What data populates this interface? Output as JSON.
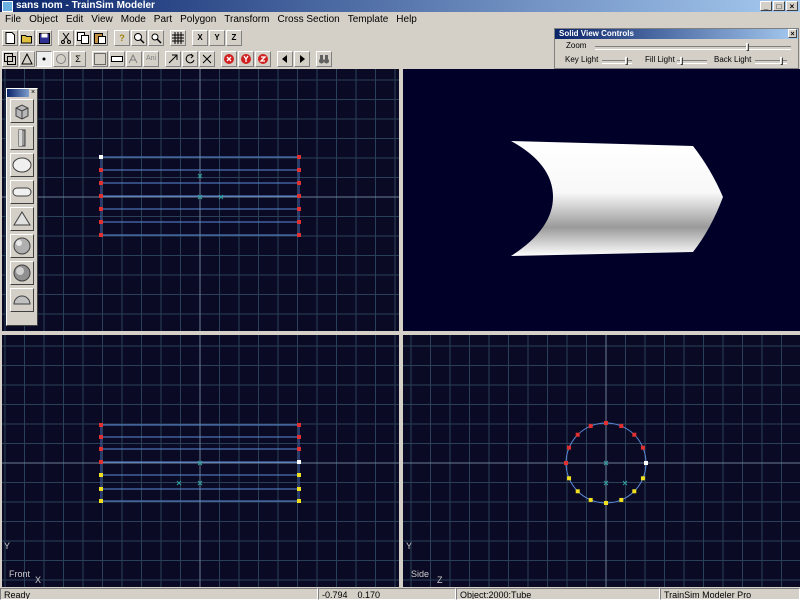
{
  "window": {
    "title": "sans nom - TrainSim Modeler",
    "controls": [
      "_",
      "□",
      "×"
    ]
  },
  "menu": [
    "File",
    "Object",
    "Edit",
    "View",
    "Mode",
    "Part",
    "Polygon",
    "Transform",
    "Cross Section",
    "Template",
    "Help"
  ],
  "toolbar": {
    "row1": [
      "new-icon",
      "open-icon",
      "save-icon",
      "cut-icon",
      "copy-icon",
      "paste-icon",
      "help-icon",
      "zoom-in-icon",
      "zoom-out-icon",
      "grid-icon",
      "align-x-icon",
      "align-y-icon",
      "align-z-icon"
    ],
    "row2": [
      "select-box-icon",
      "triangle-icon",
      "point-icon",
      "circle-icon",
      "sigma-icon",
      "select-dots-icon",
      "ruler-icon",
      "text-icon",
      "ani-icon",
      "arrow-icon",
      "rotate-icon",
      "scale-icon",
      "stop-x-icon",
      "stop-y-icon",
      "stop-z-icon",
      "prev-icon",
      "next-icon",
      "binoculars-icon"
    ],
    "text_buttons": {
      "sigma": "Σ",
      "ani": "Ani",
      "x": "X",
      "y": "Y",
      "z": "Z"
    }
  },
  "solid_view_controls": {
    "title": "Solid View Controls",
    "zoom_label": "Zoom",
    "key_light_label": "Key Light",
    "fill_light_label": "Fill Light",
    "back_light_label": "Back Light",
    "zoom_value": 0.78,
    "key_light_value": 0.85,
    "fill_light_value": 0.1,
    "back_light_value": 0.85
  },
  "palette": {
    "tools": [
      "box-icon",
      "cylinder-icon",
      "ellipse-icon",
      "capsule-icon",
      "cone-icon",
      "sphere-icon",
      "hemisphere-icon",
      "half-sphere-icon"
    ]
  },
  "viewports": {
    "top": {
      "grid_color": "#2c4a6a",
      "wire_color": "#5a8ad8"
    },
    "front": {
      "label": "Front",
      "axis_x": "X",
      "axis_y": "Y"
    },
    "side": {
      "label": "Side",
      "axis_x": "Z",
      "axis_y": "Y"
    },
    "solid": {
      "object": "tube"
    }
  },
  "statusbar": {
    "status": "Ready",
    "coords": "-0.794    0.170",
    "object": "Object:2000:Tube",
    "product": "TrainSim Modeler Pro"
  },
  "colors": {
    "viewport_bg": "#0a0a24",
    "vertex_red": "#e03030",
    "vertex_yellow": "#f0e020",
    "vertex_white": "#ffffff"
  }
}
